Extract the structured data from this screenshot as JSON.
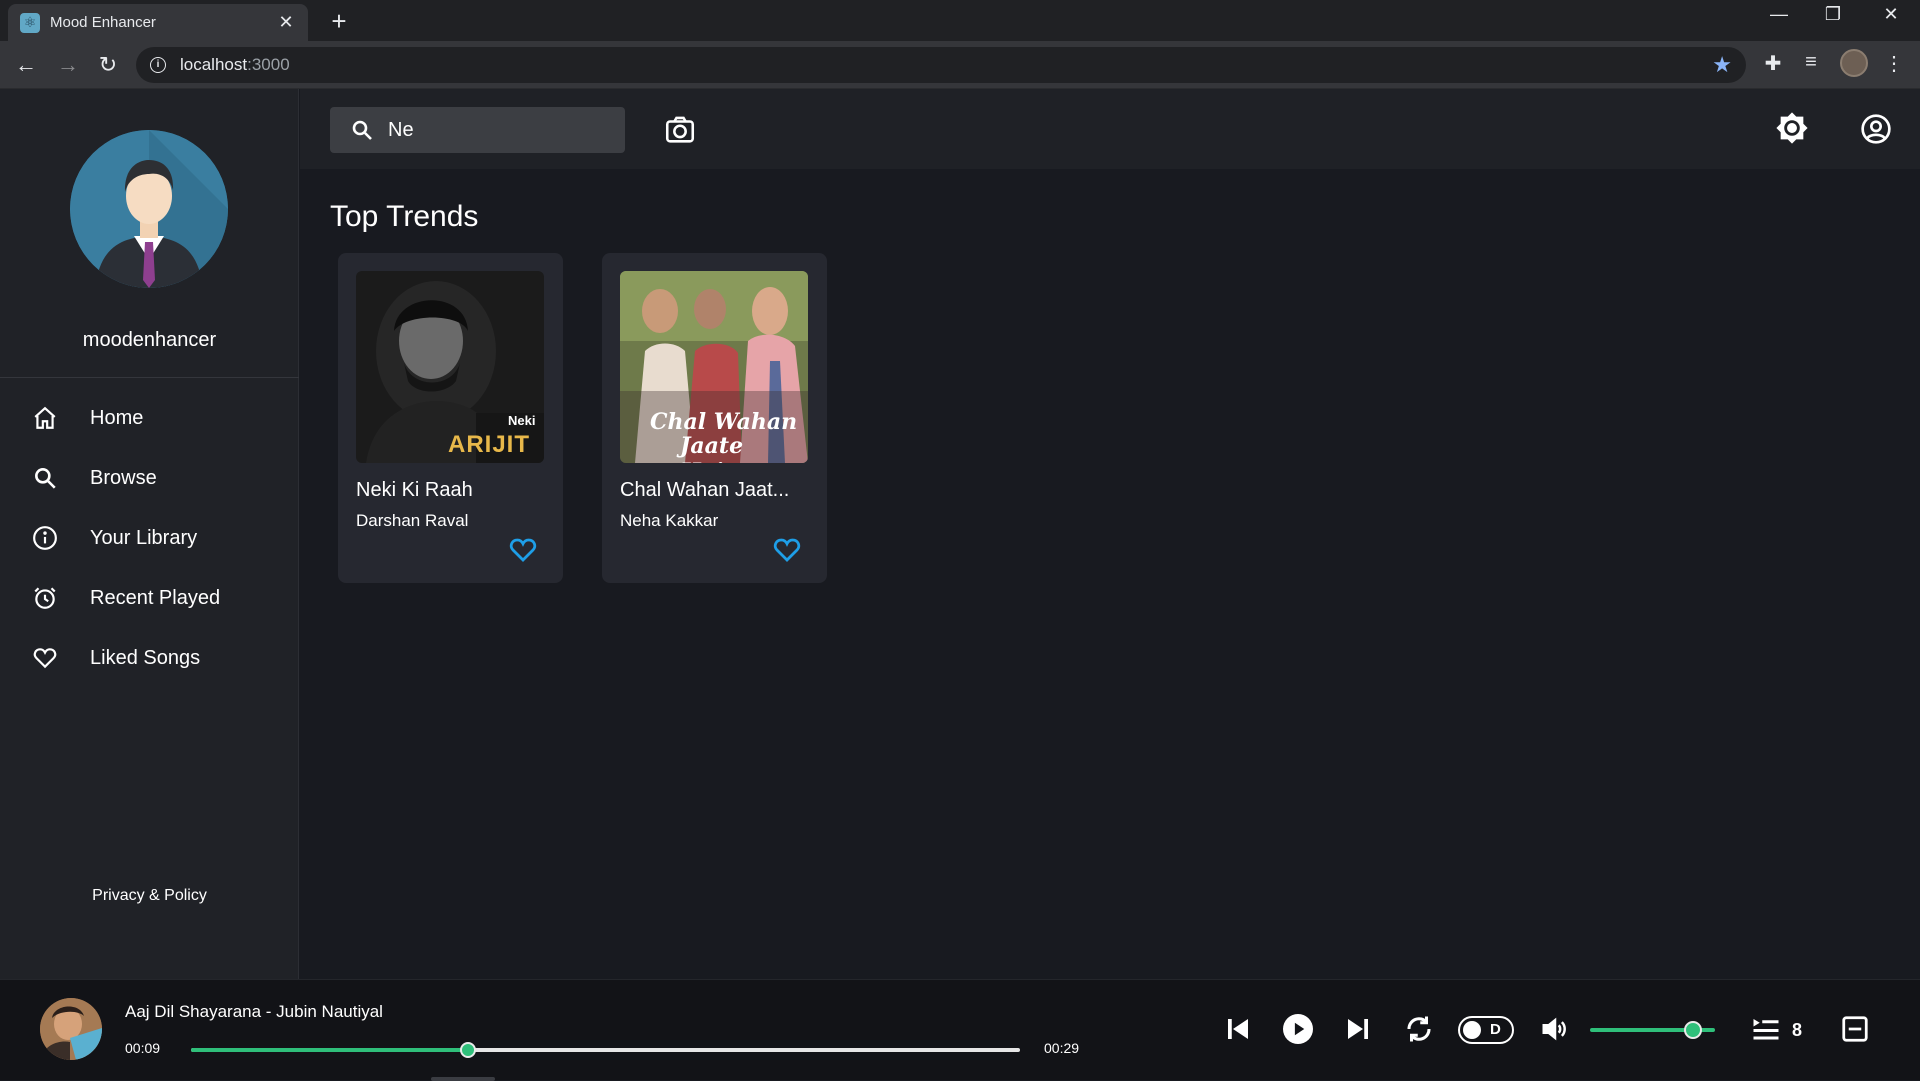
{
  "browser": {
    "tab_title": "Mood Enhancer",
    "url_host": "localhost",
    "url_port": ":3000"
  },
  "sidebar": {
    "username": "moodenhancer",
    "items": [
      {
        "label": "Home",
        "icon": "home-icon"
      },
      {
        "label": "Browse",
        "icon": "search-icon"
      },
      {
        "label": "Your Library",
        "icon": "info-icon"
      },
      {
        "label": "Recent Played",
        "icon": "alarm-clock-icon"
      },
      {
        "label": "Liked Songs",
        "icon": "heart-icon"
      }
    ],
    "privacy_label": "Privacy & Policy"
  },
  "topbar": {
    "search_value": "Ne"
  },
  "main": {
    "section_title": "Top Trends",
    "cards": [
      {
        "title": "Neki Ki Raah",
        "artist": "Darshan Raval",
        "cover_caption_small": "Neki",
        "cover_caption_large": "ARIJIT SI"
      },
      {
        "title": "Chal Wahan Jaat...",
        "artist": "Neha Kakkar",
        "cover_caption_line1": "Chal Wahan",
        "cover_caption_line2": "Jaate Hain"
      }
    ]
  },
  "player": {
    "now_playing": "Aaj Dil Shayarana - Jubin Nautiyal",
    "current_time": "00:09",
    "duration": "00:29",
    "progress_fraction": 0.334,
    "volume_fraction": 0.82,
    "shuffle_label": "D",
    "queue_count": "8"
  },
  "colors": {
    "accent_green": "#2fbf7a",
    "heart_blue": "#1e9fe8",
    "bookmark_star": "#8ab4f8"
  }
}
